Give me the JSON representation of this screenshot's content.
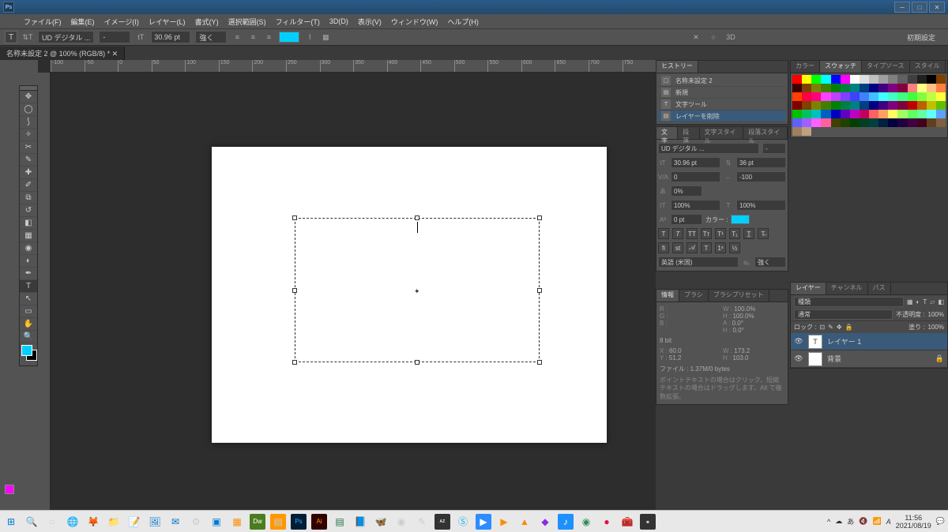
{
  "titlebar": {
    "logo": "Ps"
  },
  "menu": [
    "ファイル(F)",
    "編集(E)",
    "イメージ(I)",
    "レイヤー(L)",
    "書式(Y)",
    "選択範囲(S)",
    "フィルター(T)",
    "3D(D)",
    "表示(V)",
    "ウィンドウ(W)",
    "ヘルプ(H)"
  ],
  "options": {
    "font": "UD デジタル ...",
    "style": "-",
    "size_icon": "tT",
    "size": "30.96 pt",
    "aa": "強く",
    "right_workspace": "初期設定"
  },
  "doctab": "名称未設定 2 @ 100% (RGB/8) *",
  "ruler_ticks": [
    "-100",
    "-50",
    "0",
    "50",
    "100",
    "150",
    "200",
    "250",
    "300",
    "350",
    "400",
    "450",
    "500",
    "550",
    "600",
    "650",
    "700",
    "750"
  ],
  "history": {
    "tab": "ヒストリー",
    "snapshot": "名称未設定 2",
    "items": [
      "新規",
      "文字ツール",
      "レイヤーを削除"
    ]
  },
  "char": {
    "tabs": [
      "文字",
      "段落",
      "文字スタイル",
      "段落スタイル"
    ],
    "font": "UD デジタル ...",
    "style": "-",
    "size": "30.96 pt",
    "leading": "36 pt",
    "va": "0",
    "tracking": "-100",
    "scale": "0%",
    "height": "100%",
    "width": "100%",
    "baseline": "0 pt",
    "color_label": "カラー :",
    "lang": "英語 (米国)",
    "aa": "強く"
  },
  "info": {
    "tabs": [
      "情報",
      "ブラシ",
      "ブラシプリセット"
    ],
    "r": "R :",
    "g": "G :",
    "b": "B :",
    "w1": "W :",
    "w1v": "100.0%",
    "h1": "H :",
    "h1v": "100.0%",
    "a": "A :",
    "av": "0.0°",
    "hh": "H :",
    "hhv": "0.0°",
    "depth": "8 bit",
    "x": "X :",
    "xv": "60.0",
    "y": "Y :",
    "yv": "51.2",
    "w2": "W :",
    "w2v": "173.2",
    "h2": "H :",
    "h2v": "103.0",
    "file": "ファイル : 1.37M/0 bytes",
    "hint": "ポイントテキストの場合はクリック、短縮テキストの場合はドラッグします。Alt で複数拡張。"
  },
  "color_tabs": [
    "カラー",
    "スウォッチ",
    "タイプソース",
    "スタイル"
  ],
  "swatch_colors": [
    "#ff0000",
    "#ffff00",
    "#00ff00",
    "#00ffff",
    "#0000ff",
    "#ff00ff",
    "#ffffff",
    "#e0e0e0",
    "#c0c0c0",
    "#a0a0a0",
    "#808080",
    "#606060",
    "#404040",
    "#202020",
    "#000000",
    "#804000",
    "#400000",
    "#804000",
    "#808000",
    "#408000",
    "#008000",
    "#008040",
    "#008080",
    "#004080",
    "#000080",
    "#400080",
    "#800080",
    "#800040",
    "#ff8080",
    "#ffff80",
    "#ffc080",
    "#ff8040",
    "#ff4000",
    "#ff0040",
    "#ff0080",
    "#ff40ff",
    "#c040ff",
    "#8040ff",
    "#4040ff",
    "#4080ff",
    "#40c0ff",
    "#40ffff",
    "#40ffc0",
    "#40ff80",
    "#40ff40",
    "#80ff40",
    "#c0ff40",
    "#ffff40",
    "#800000",
    "#804000",
    "#808000",
    "#408000",
    "#008000",
    "#008040",
    "#008080",
    "#004080",
    "#000080",
    "#400080",
    "#800080",
    "#800040",
    "#c00000",
    "#c06000",
    "#c0c000",
    "#60c000",
    "#00c000",
    "#00c060",
    "#00c0c0",
    "#0060c0",
    "#0000c0",
    "#6000c0",
    "#c000c0",
    "#c00060",
    "#ff6060",
    "#ffa060",
    "#ffff60",
    "#a0ff60",
    "#60ff60",
    "#60ffa0",
    "#60ffff",
    "#60a0ff",
    "#6060ff",
    "#a060ff",
    "#ff60ff",
    "#ff60a0",
    "#404000",
    "#204000",
    "#004000",
    "#004020",
    "#004040",
    "#002040",
    "#000040",
    "#200040",
    "#400040",
    "#400020",
    "#604020",
    "#806040",
    "#a08060",
    "#c0a080"
  ],
  "layers": {
    "tabs": [
      "レイヤー",
      "チャンネル",
      "パス"
    ],
    "kind": "種類",
    "blend": "通常",
    "opacity_label": "不透明度 :",
    "opacity": "100%",
    "lock_label": "ロック :",
    "fill_label": "塗り :",
    "fill": "100%",
    "items": [
      {
        "name": "レイヤー 1",
        "type": "T",
        "sel": true
      },
      {
        "name": "背景",
        "type": "bg",
        "sel": false
      }
    ]
  },
  "status": {
    "zoom": "100%",
    "file": "ファイル : 1.37M/0 bytes"
  },
  "tray": {
    "time": "11:56",
    "date": "2021/08/19"
  }
}
